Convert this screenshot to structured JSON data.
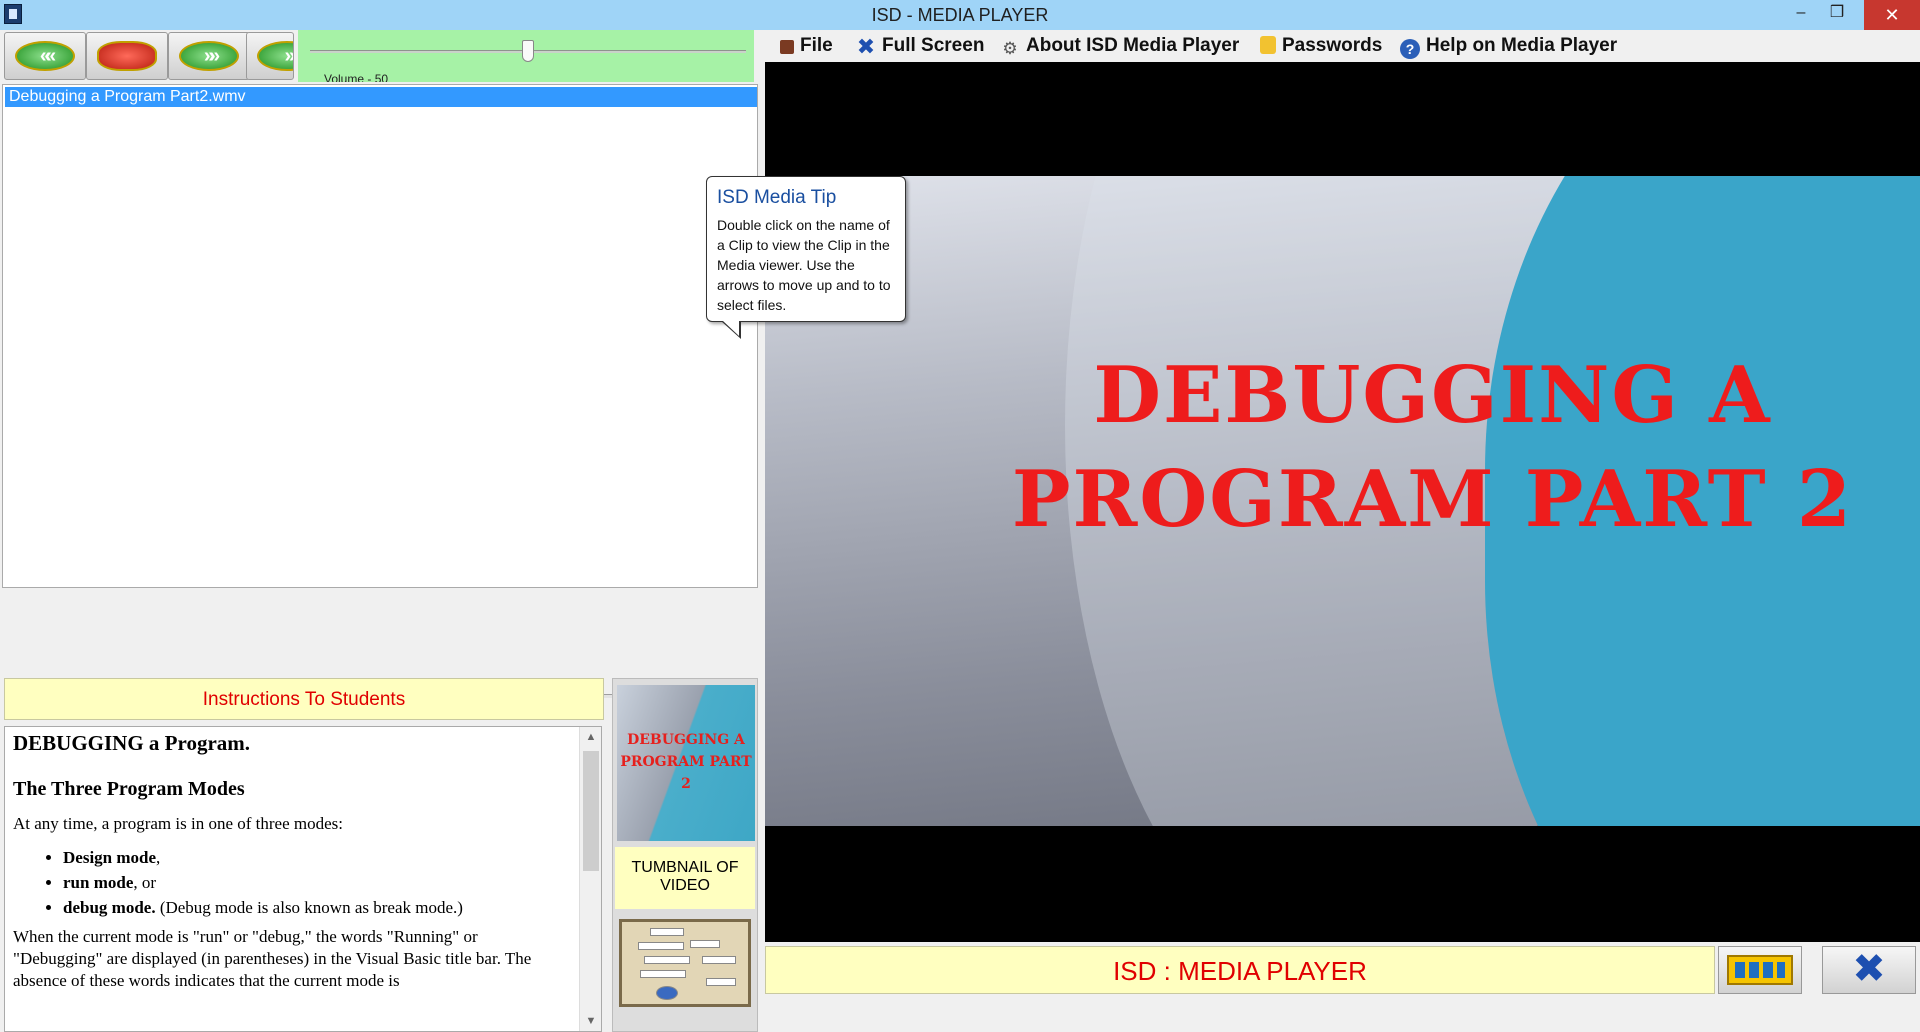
{
  "window": {
    "title": "ISD - MEDIA PLAYER",
    "minimize": "–",
    "maximize": "❒",
    "close": "✕"
  },
  "transport": {
    "buttons": [
      {
        "name": "previous",
        "glyph": "««",
        "color": "#2a9d2a"
      },
      {
        "name": "stop",
        "glyph": "",
        "color": "#c8281a"
      },
      {
        "name": "next",
        "glyph": "»»",
        "color": "#2a9d2a"
      },
      {
        "name": "play",
        "glyph": "»",
        "color": "#2a9d2a"
      }
    ],
    "volume_label": "Volume - 50",
    "volume_level": 0.5,
    "seek_position": 0.0
  },
  "playlist": {
    "items": [
      "Debugging a Program Part2.wmv"
    ],
    "selected_index": 0
  },
  "tooltip": {
    "title": "ISD Media Tip",
    "text": "Double click on the name of a Clip to view the Clip in the Media viewer. Use the arrows to move up and to to select files."
  },
  "instructions": {
    "header": "Instructions To Students",
    "heading": "DEBUGGING a Program.",
    "subheading": "The Three Program Modes",
    "intro": "At any time, a program is in one of three modes:",
    "modes": [
      {
        "bold": "Design mode",
        "rest": ","
      },
      {
        "bold": "run mode",
        "rest": ", or"
      },
      {
        "bold": "debug mode.",
        "rest": " (Debug mode is also known as break mode.)"
      }
    ],
    "paragraph": "When the current mode is \"run\" or \"debug,\" the words \"Running\" or \"Debugging\" are displayed (in parentheses) in the Visual Basic title bar. The absence of these words indicates that the current mode is"
  },
  "thumbnail": {
    "video_title": "DEBUGGING A PROGRAM PART 2",
    "caption": "TUMBNAIL OF VIDEO"
  },
  "menu": {
    "items": [
      {
        "label": "File",
        "icon": "film-icon"
      },
      {
        "label": "Full Screen",
        "icon": "fullscreen-x-icon"
      },
      {
        "label": "About ISD Media Player",
        "icon": "gear-icon"
      },
      {
        "label": "Passwords",
        "icon": "lock-icon"
      },
      {
        "label": "Help on Media Player",
        "icon": "help-icon"
      }
    ]
  },
  "video": {
    "title_line1": "DEBUGGING A",
    "title_line2": "PROGRAM PART 2"
  },
  "status": {
    "text": "ISD : MEDIA PLAYER"
  },
  "colors": {
    "title_bar": "#9fd4f7",
    "volume_panel": "#a6f2a6",
    "selection": "#3399ff",
    "label_bg": "#ffffc0",
    "accent_red": "#e00000",
    "video_title_red": "#ee1c1c",
    "video_teal": "#42a8c8"
  }
}
